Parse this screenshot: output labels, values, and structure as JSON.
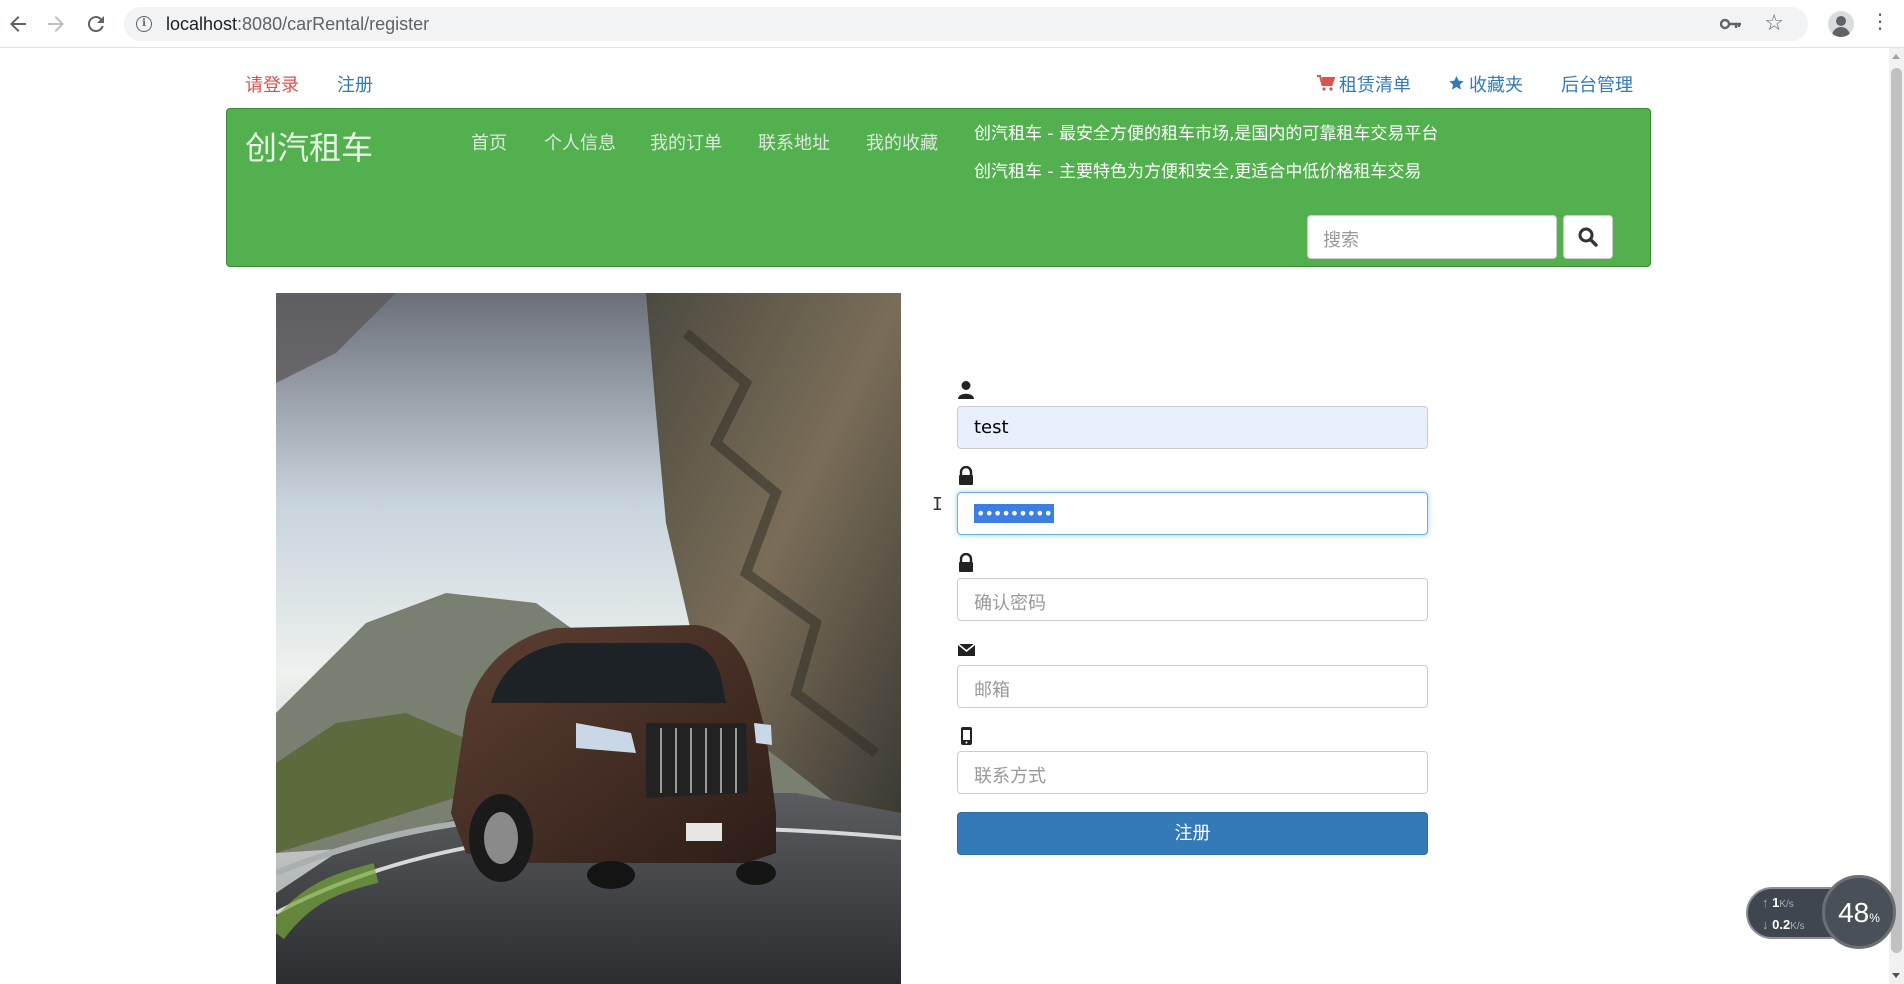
{
  "browser": {
    "url_host": "localhost",
    "url_path": ":8080/carRental/register"
  },
  "topbar": {
    "login_label": "请登录",
    "register_label": "注册",
    "rental_list_label": "租赁清单",
    "favorites_label": "收藏夹",
    "admin_label": "后台管理"
  },
  "header": {
    "brand": "创汽租车",
    "nav": [
      "首页",
      "个人信息",
      "我的订单",
      "联系地址",
      "我的收藏"
    ],
    "tagline_1": "创汽租车 - 最安全方便的租车市场,是国内的可靠租车交易平台",
    "tagline_2": "创汽租车 - 主要特色为方便和安全,更适合中低价格租车交易",
    "search_placeholder": "搜索"
  },
  "form": {
    "username_value": "test",
    "password_masked": "•••••••••",
    "confirm_placeholder": "确认密码",
    "email_placeholder": "邮箱",
    "contact_placeholder": "联系方式",
    "submit_label": "注册"
  },
  "speed_widget": {
    "upload": "1",
    "download": "0.2",
    "unit": "K/s",
    "percent": "48",
    "percent_sign": "%"
  },
  "colors": {
    "header_green": "#52b04e",
    "link_blue": "#337ab7",
    "login_red": "#d9534f",
    "button_blue": "#337ab7"
  }
}
